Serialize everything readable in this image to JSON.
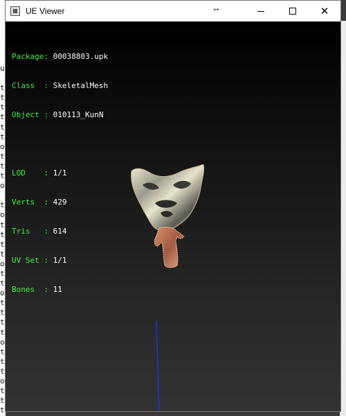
{
  "window": {
    "title": "UE Viewer",
    "icon": "app-icon",
    "controls": {
      "minimize": "minimize-icon",
      "maximize": "maximize-icon",
      "close": "close-icon"
    }
  },
  "background": {
    "left_chars": "u\n\nt\nt\nt\nt\nt\nt\no\nt\nt\nt\no\n\nt\no\nt\nt\nt\nt\no\nt\nt\no\nt\nt\nt\nt\no\nt\nt\nt\no\nt\nt\nt\nt\no"
  },
  "info": {
    "package_label": "Package",
    "package_value": "00038803.upk",
    "class_label": "Class",
    "class_value": "SkeletalMesh",
    "object_label": "Object",
    "object_value": "010113_KunN",
    "lod_label": "LOD",
    "lod_value": "1/1",
    "verts_label": "Verts",
    "verts_value": "429",
    "tris_label": "Tris",
    "tris_value": "614",
    "uvset_label": "UV Set",
    "uvset_value": "1/1",
    "bones_label": "Bones",
    "bones_value": "11"
  },
  "colors": {
    "label": "#44ee44",
    "value": "#ffffff",
    "axis": "#2233cc"
  }
}
